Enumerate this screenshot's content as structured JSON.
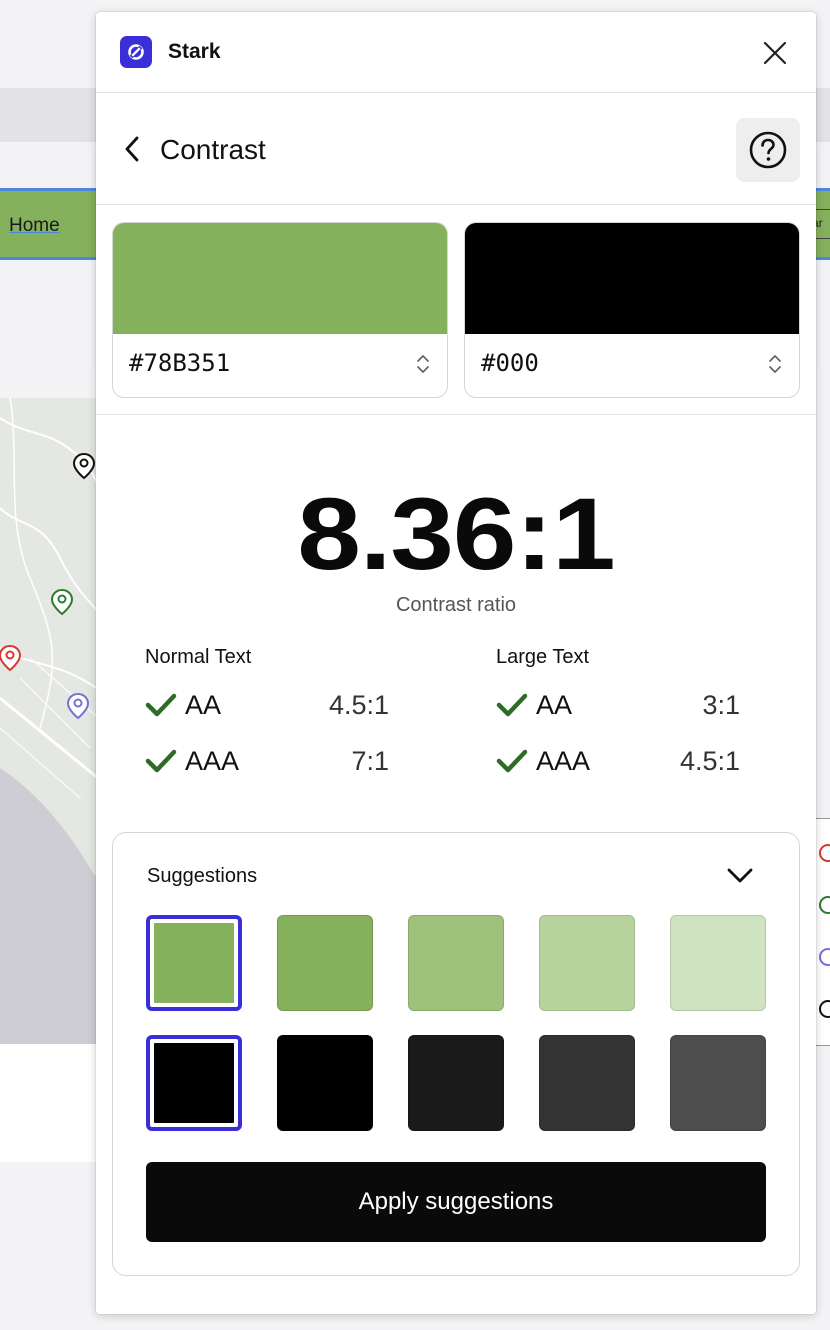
{
  "background": {
    "nav_home_label": "Home",
    "nav_right_label": "ar",
    "nav_color": "#85b05c"
  },
  "app": {
    "name": "Stark",
    "logo_icon": "stark-logo-icon",
    "brand_color": "#3a2fd6"
  },
  "header": {
    "title": "Contrast",
    "back_icon": "chevron-left-icon",
    "help_icon": "question-circle-icon"
  },
  "colors": {
    "foreground": {
      "hex": "#78B351",
      "swatch": "#85b05c"
    },
    "background": {
      "hex": "#000",
      "swatch": "#000000"
    }
  },
  "ratio": {
    "value": "8.36:1",
    "label": "Contrast ratio"
  },
  "results": {
    "normal": {
      "heading": "Normal Text",
      "rows": [
        {
          "level": "AA",
          "threshold": "4.5:1",
          "pass": true
        },
        {
          "level": "AAA",
          "threshold": "7:1",
          "pass": true
        }
      ]
    },
    "large": {
      "heading": "Large Text",
      "rows": [
        {
          "level": "AA",
          "threshold": "3:1",
          "pass": true
        },
        {
          "level": "AAA",
          "threshold": "4.5:1",
          "pass": true
        }
      ]
    },
    "pass_color": "#2e6b27"
  },
  "suggestions": {
    "title": "Suggestions",
    "toggle_icon": "chevron-down-icon",
    "foreground_swatches": [
      "#85b05c",
      "#85b05c",
      "#9ec27c",
      "#b8d49e",
      "#d0e3c0"
    ],
    "background_swatches": [
      "#000000",
      "#000000",
      "#1a1a1a",
      "#333333",
      "#4d4d4d"
    ],
    "selected_index": 0,
    "apply_label": "Apply suggestions"
  }
}
